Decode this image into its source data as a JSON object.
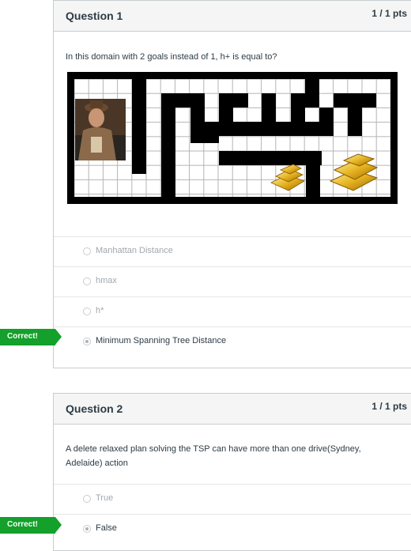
{
  "colors": {
    "correct_green": "#13a02b",
    "header_bg": "#f5f5f5",
    "border": "#c7cdd1"
  },
  "questions": [
    {
      "title": "Question 1",
      "points": "1 / 1 pts",
      "text": "In this domain with 2 goals instead of 1, h+ is equal to?",
      "image": {
        "icon": "maze-icon",
        "pieces": [
          "explorer-icon",
          "gold-bars-small-icon",
          "gold-bars-large-icon"
        ]
      },
      "answers": [
        {
          "label": "Manhattan Distance",
          "selected": false
        },
        {
          "label": "hmax",
          "selected": false
        },
        {
          "label": "h*",
          "selected": false
        },
        {
          "label": "Minimum Spanning Tree Distance",
          "selected": true
        }
      ],
      "result": "Correct!"
    },
    {
      "title": "Question 2",
      "points": "1 / 1 pts",
      "text": "A delete relaxed plan solving the TSP can have more than one drive(Sydney, Adelaide) action",
      "answers": [
        {
          "label": "True",
          "selected": false
        },
        {
          "label": "False",
          "selected": true
        }
      ],
      "result": "Correct!"
    }
  ]
}
